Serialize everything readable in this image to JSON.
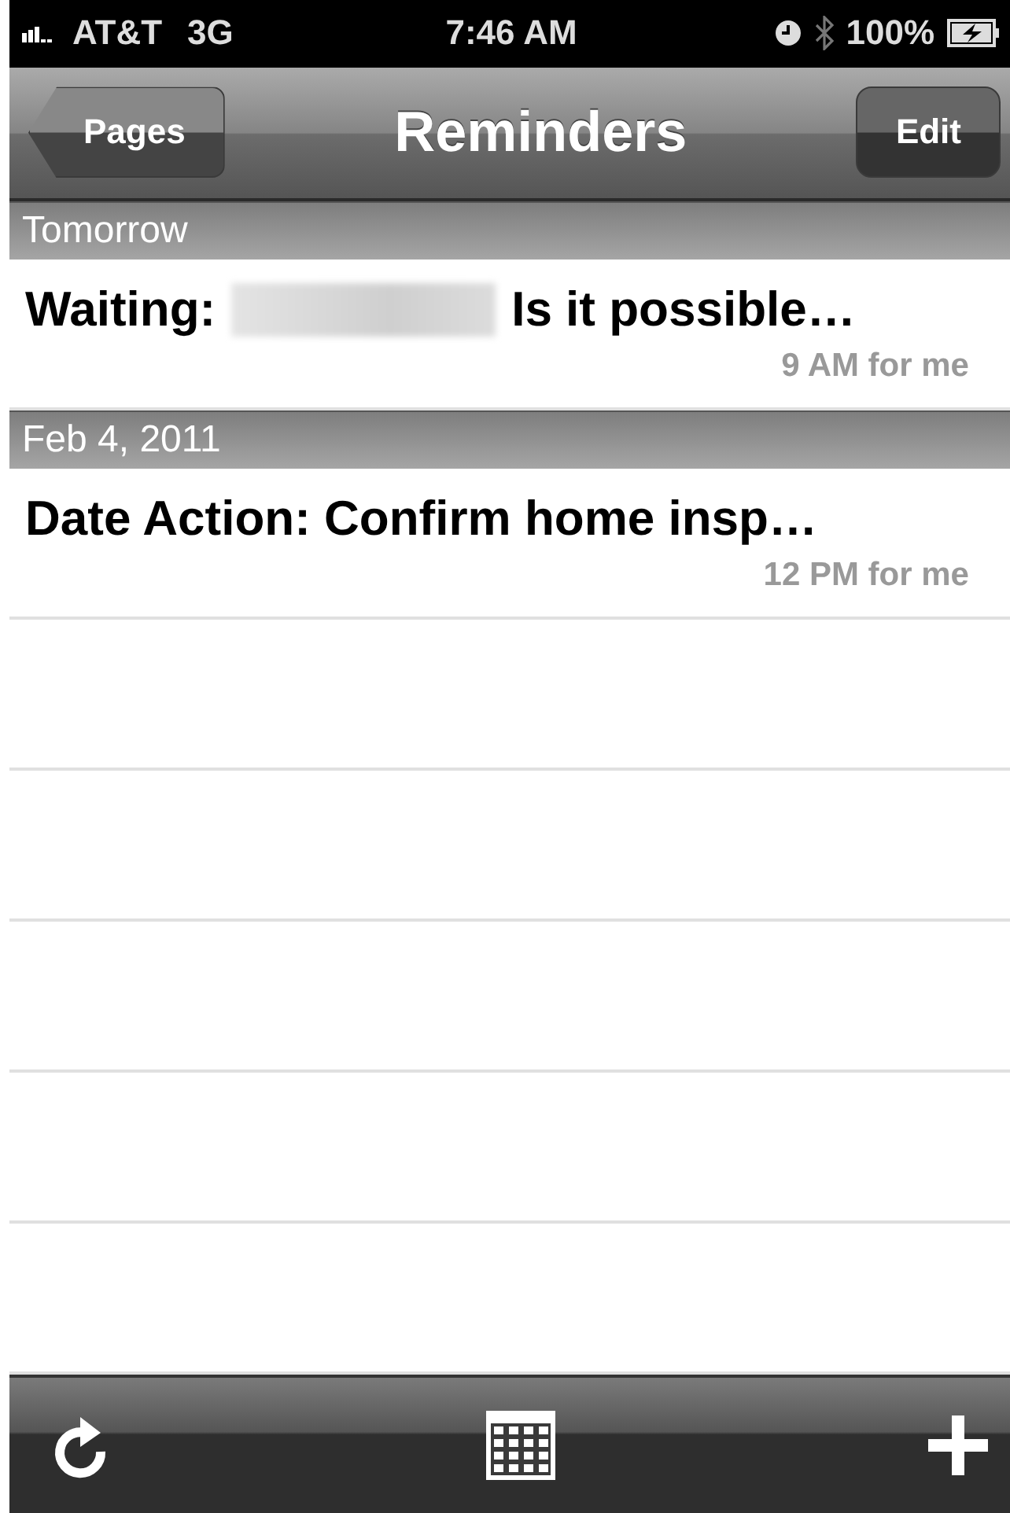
{
  "status_bar": {
    "carrier": "AT&T",
    "network": "3G",
    "time": "7:46 AM",
    "battery": "100%"
  },
  "nav_bar": {
    "back": "Pages",
    "title": "Reminders",
    "action": "Edit"
  },
  "sections": [
    {
      "header": "Tomorrow",
      "items": [
        {
          "title_before": "Waiting:",
          "redacted": true,
          "title_after": "Is it possible…",
          "detail": "9 AM for me"
        }
      ]
    },
    {
      "header": "Feb 4, 2011",
      "items": [
        {
          "title_before": "Date Action: Confirm home insp…",
          "redacted": false,
          "detail": "12 PM for me"
        }
      ]
    }
  ]
}
